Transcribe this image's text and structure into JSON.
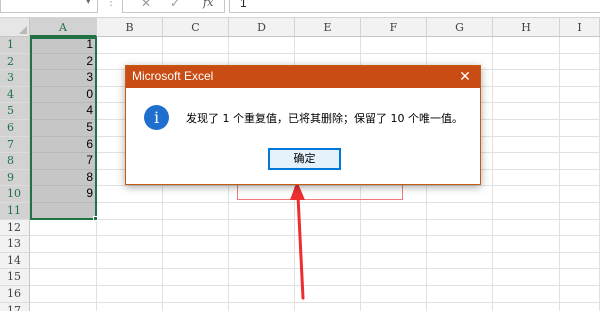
{
  "formula_bar": {
    "cancel_glyph": "✕",
    "enter_glyph": "✓",
    "fx_label": "fx",
    "value": "1"
  },
  "columns": [
    "A",
    "B",
    "C",
    "D",
    "E",
    "F",
    "G",
    "H",
    "I"
  ],
  "rows": [
    "1",
    "2",
    "3",
    "4",
    "5",
    "6",
    "7",
    "8",
    "9",
    "10",
    "11",
    "12",
    "13",
    "14",
    "15",
    "16",
    "17"
  ],
  "column_a_values": [
    "1",
    "2",
    "3",
    "0",
    "4",
    "5",
    "6",
    "7",
    "8",
    "9",
    "",
    "",
    "",
    "",
    "",
    "",
    ""
  ],
  "selection": {
    "range": "A1:A11",
    "active_column": "A"
  },
  "dialog": {
    "title": "Microsoft Excel",
    "close_glyph": "✕",
    "icon_glyph": "i",
    "message": "发现了 1 个重复值，已将其删除；保留了 10 个唯一值。",
    "ok_label": "确定"
  },
  "colors": {
    "excel_green": "#217346",
    "dialog_title_bar": "#c84c13",
    "info_blue": "#1e6fce",
    "annotation_red": "#f07a7a"
  }
}
